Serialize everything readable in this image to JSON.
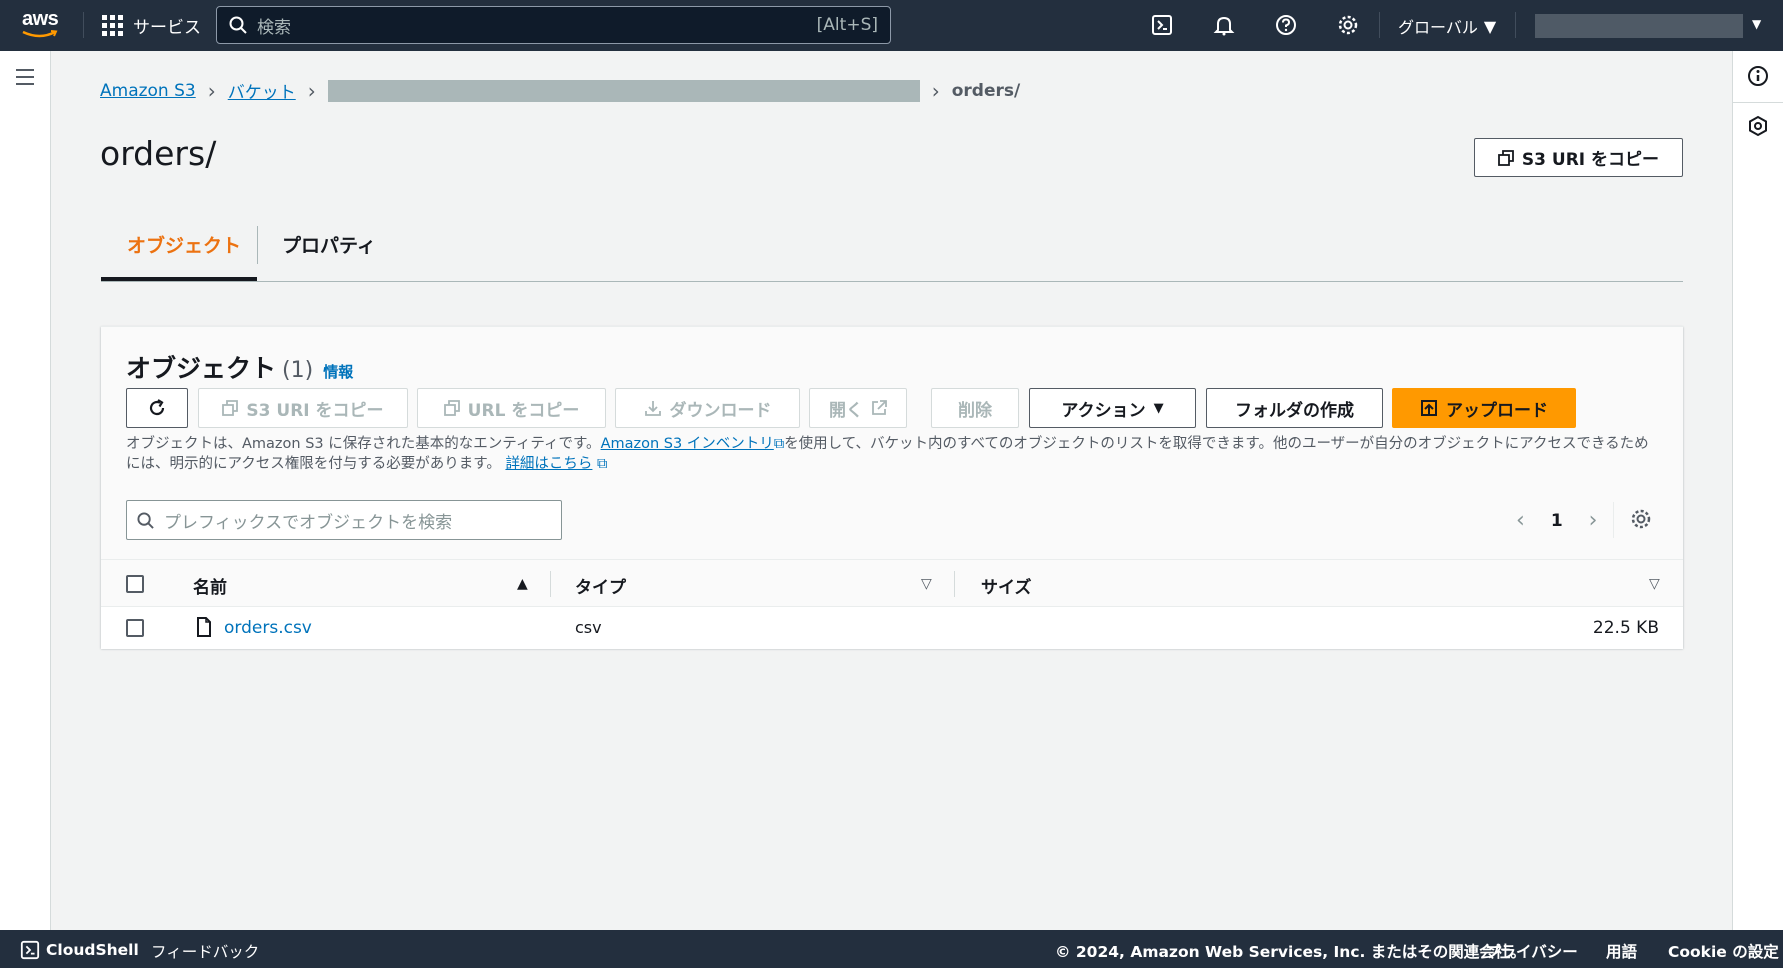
{
  "topbar": {
    "logo": "aws",
    "services_label": "サービス",
    "search_placeholder": "検索",
    "search_shortcut": "[Alt+S]",
    "region_label": "グローバル",
    "icons": [
      "cloudshell-icon",
      "bell-icon",
      "help-icon",
      "gear-icon"
    ]
  },
  "breadcrumb": {
    "items": [
      "Amazon S3",
      "バケット"
    ],
    "current": "orders/"
  },
  "page": {
    "title": "orders/",
    "copy_uri_label": "S3 URI をコピー"
  },
  "tabs": [
    {
      "label": "オブジェクト",
      "active": true
    },
    {
      "label": "プロパティ",
      "active": false
    }
  ],
  "objects_panel": {
    "title": "オブジェクト",
    "count": "(1)",
    "info_link": "情報",
    "toolbar": {
      "copy_s3_uri": "S3 URI をコピー",
      "copy_url": "URL をコピー",
      "download": "ダウンロード",
      "open": "開く",
      "delete": "削除",
      "actions": "アクション",
      "create_folder": "フォルダの作成",
      "upload": "アップロード"
    },
    "description_part1": "オブジェクトは、Amazon S3 に保存された基本的なエンティティです。",
    "inventory_link": "Amazon S3 インベントリ",
    "description_part2": "を使用して、バケット内のすべてのオブジェクトのリストを取得できます。他のユーザーが自分のオブジェクトにアクセスできるためには、明示的にアクセス権限を付与する必要があります。",
    "details_link": "詳細はこちら",
    "search_placeholder": "プレフィックスでオブジェクトを検索",
    "page_number": "1",
    "columns": [
      "名前",
      "タイプ",
      "サイズ"
    ],
    "rows": [
      {
        "name": "orders.csv",
        "type": "csv",
        "size": "22.5 KB"
      }
    ]
  },
  "footer": {
    "cloudshell": "CloudShell",
    "feedback": "フィードバック",
    "copyright": "© 2024, Amazon Web Services, Inc. またはその関連会社。",
    "privacy": "プライバシー",
    "terms": "用語",
    "cookie": "Cookie の設定"
  },
  "colors": {
    "topbar_bg": "#232f3e",
    "link": "#0073bb",
    "accent": "#ec7211",
    "primary_button": "#ff9900"
  }
}
